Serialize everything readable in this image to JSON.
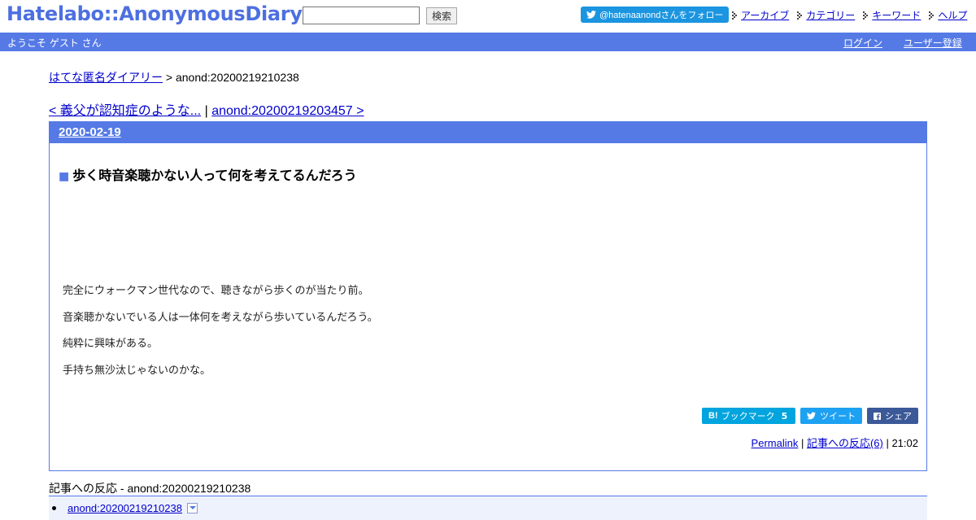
{
  "header": {
    "logo": "Hatelabo::AnonymousDiary",
    "search": {
      "value": "",
      "placeholder": ""
    },
    "search_button": "検索",
    "follow_button": "@hatenaanondさんをフォロー",
    "nav": [
      "アーカイブ",
      "カテゴリー",
      "キーワード",
      "ヘルプ"
    ]
  },
  "userbar": {
    "welcome": "ようこそ ゲスト さん",
    "login": "ログイン",
    "register": "ユーザー登録"
  },
  "breadcrumb": {
    "home": "はてな匿名ダイアリー",
    "separator": " > ",
    "current": "anond:20200219210238"
  },
  "pager": {
    "prev": "< 義父が認知症のような...",
    "separator": " | ",
    "next": "anond:20200219203457 >"
  },
  "day": {
    "date": "2020-02-19",
    "entry": {
      "marker": "■",
      "title": "歩く時音楽聴かない人って何を考えてるんだろう",
      "paragraphs": [
        "完全にウォークマン世代なので、聴きながら歩くのが当たり前。",
        "音楽聴かないでいる人は一体何を考えながら歩いているんだろう。",
        "純粋に興味がある。",
        "手持ち無沙汰じゃないのかな。"
      ],
      "share": {
        "hatena_label": "ブックマーク",
        "hatena_logo": "B!",
        "hatena_count": "5",
        "tweet_label": "ツイート",
        "facebook_label": "シェア"
      },
      "footer": {
        "permalink": "Permalink",
        "sep1": " | ",
        "reactions": "記事への反応(6)",
        "sep2": " | ",
        "time": "21:02"
      }
    }
  },
  "reactions": {
    "title": "記事への反応 - anond:20200219210238",
    "items": [
      "anond:20200219210238"
    ]
  },
  "colors": {
    "accent": "#557ae6",
    "logo": "#4d6fe0",
    "twitter": "#1da1f2",
    "hatena": "#00a4de",
    "facebook": "#3b5998"
  }
}
